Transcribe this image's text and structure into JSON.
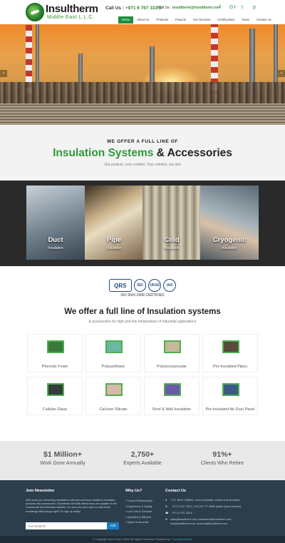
{
  "header": {
    "logo_title": "Insultherm",
    "logo_sub": "Middle East L.L.C.",
    "call_label": "Call Us :",
    "call_number": "+971 6 767 333 0",
    "mail_label": "Mail Us :",
    "mail_address": "insultherm@insultherm.com",
    "social": [
      {
        "icon": "facebook-icon",
        "glyph": "f"
      },
      {
        "icon": "google-plus-icon",
        "glyph": "G+"
      },
      {
        "icon": "twitter-icon",
        "glyph": "t"
      },
      {
        "icon": "pinterest-icon",
        "glyph": "p"
      }
    ]
  },
  "nav": [
    {
      "label": "Home",
      "active": true
    },
    {
      "label": "About Us"
    },
    {
      "label": "Products"
    },
    {
      "label": "Projects"
    },
    {
      "label": "Our Services"
    },
    {
      "label": "Certifications"
    },
    {
      "label": "News"
    },
    {
      "label": "Contact Us"
    }
  ],
  "hero": {
    "prev_glyph": "‹",
    "next_glyph": "›"
  },
  "offer": {
    "kicker": "WE OFFER A FULL LINE OF",
    "title_green": "Insulation Systems",
    "title_rest": " & Accessories",
    "subtitle": "Our product, your comfort. Your comfort, our aim"
  },
  "categories": [
    {
      "name": "Duct",
      "sub": "Insulation",
      "color": "#8a9aa6"
    },
    {
      "name": "Pipe",
      "sub": "Insulation",
      "color": "#b8a27a"
    },
    {
      "name": "Cold",
      "sub": "Insulation",
      "color": "#a8a08a"
    },
    {
      "name": "Cryogenic",
      "sub": "Insulation",
      "color": "#7a8a96"
    }
  ],
  "certs": {
    "badges": [
      "QRS",
      "ISO",
      "UKAS",
      "IAS"
    ],
    "iso_text": "ISO 9001:2008 CERTIFIED"
  },
  "systems": {
    "title": "We offer a full line of Insulation systems",
    "subtitle": "& accessories for high and low temperature of industrial applications"
  },
  "products": [
    {
      "label": "Phenolic Foam",
      "color": "#3a7a3a"
    },
    {
      "label": "Polyurethane",
      "color": "#6ab8a0"
    },
    {
      "label": "Polyisocyanurate",
      "color": "#c8b89a"
    },
    {
      "label": "Pre-Insulated Pipes",
      "color": "#5a4a3a"
    },
    {
      "label": "Cellular Glass",
      "color": "#3a3a3a"
    },
    {
      "label": "Calcium Silicate",
      "color": "#d8b8a8"
    },
    {
      "label": "Roof & Wall Insulation",
      "color": "#6a5aa8"
    },
    {
      "label": "Pre-Insulated Air Duct Panel",
      "color": "#3a5a8a"
    }
  ],
  "stats": [
    {
      "num": "$1 Million+",
      "label": "Work Done Annually"
    },
    {
      "num": "2,750+",
      "label": "Experts Available"
    },
    {
      "num": "91%+",
      "label": "Clients Who Rehire"
    }
  ],
  "footer": {
    "newsletter_head": "Join Newsletter",
    "newsletter_text": "We'll send you interesting newsletters with tips and tricks related to insulation products and accessories. Sometimes we'll talk latest news and updates in the commercial and industrial markets. For sure you don't want to miss those knowledge filled things right!! So sign up today!",
    "email_placeholder": "Your Email ID",
    "email_button": "Add",
    "why_head": "Why Us?",
    "why_items": [
      "Trust & Relationships",
      "Experience & Quality",
      "Low Cost & Genuine",
      "Specified & Efficient",
      "Speed & Accurate"
    ],
    "contact_head": "Contact Us",
    "contact_lines": [
      {
        "icon": "map-pin-icon",
        "glyph": "●",
        "text": "P.O. BOX: 335803, Umm Al Quwain, United Arab Emirates"
      },
      {
        "icon": "phone-icon",
        "glyph": "✆",
        "text": "+971 6 767 333 0, +971 52 777 6558 (Sales Quick Answer)"
      },
      {
        "icon": "fax-icon",
        "glyph": "☎",
        "text": "+971 6 767 333 6"
      },
      {
        "icon": "envelope-icon",
        "glyph": "✉",
        "text": "sales@insultherm.com, insultherm@insultherm.com, info@insultherm.com, technical@insultherm.com"
      }
    ],
    "copyright": "© Copyright Insul Therm 2016. All Rights Reserved. Powered by:",
    "powered_by": "Trueway Infotech"
  }
}
